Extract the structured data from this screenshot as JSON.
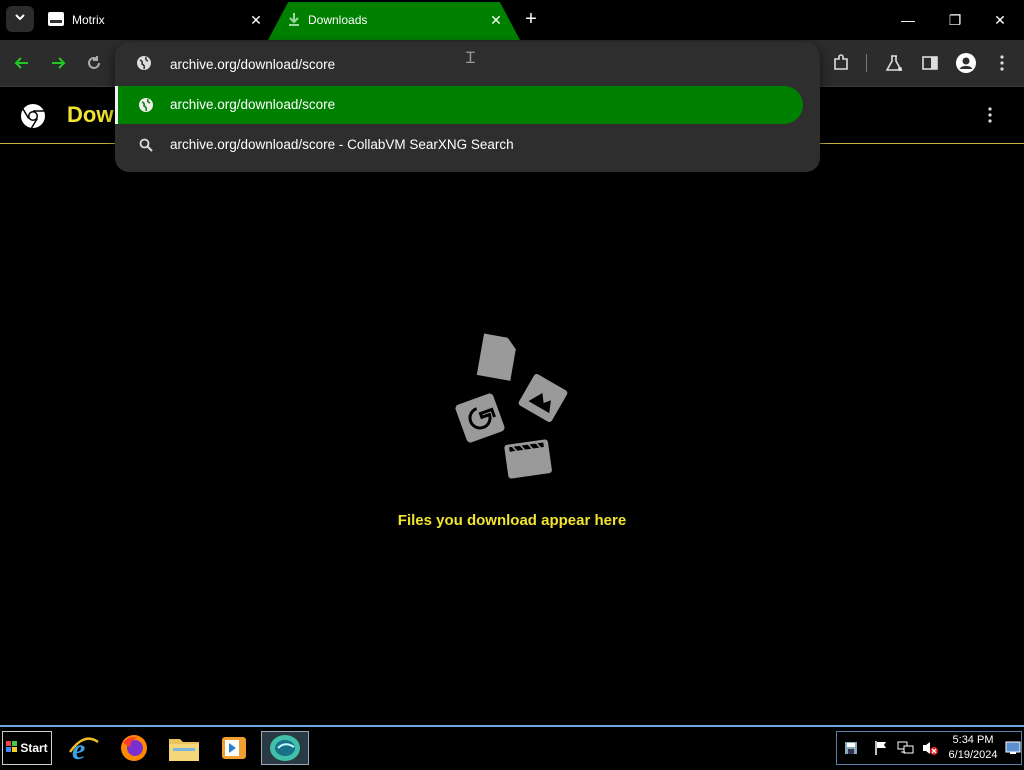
{
  "browser": {
    "tabs": [
      {
        "title": "Motrix",
        "active": false
      },
      {
        "title": "Downloads",
        "active": true
      }
    ],
    "accent_color": "#008000",
    "highlight_text_color": "#f0e430"
  },
  "omnibox": {
    "value": "archive.org/download/score",
    "suggestions": [
      {
        "icon": "globe-icon",
        "text": "archive.org/download/score",
        "selected": true
      },
      {
        "icon": "search-icon",
        "text": "archive.org/download/score - CollabVM SearXNG Search",
        "selected": false
      }
    ]
  },
  "page": {
    "title_visible": "Dowi",
    "empty_message": "Files you download appear here"
  },
  "taskbar": {
    "start_label": "Start",
    "clock_time": "5:34 PM",
    "clock_date": "6/19/2024"
  }
}
